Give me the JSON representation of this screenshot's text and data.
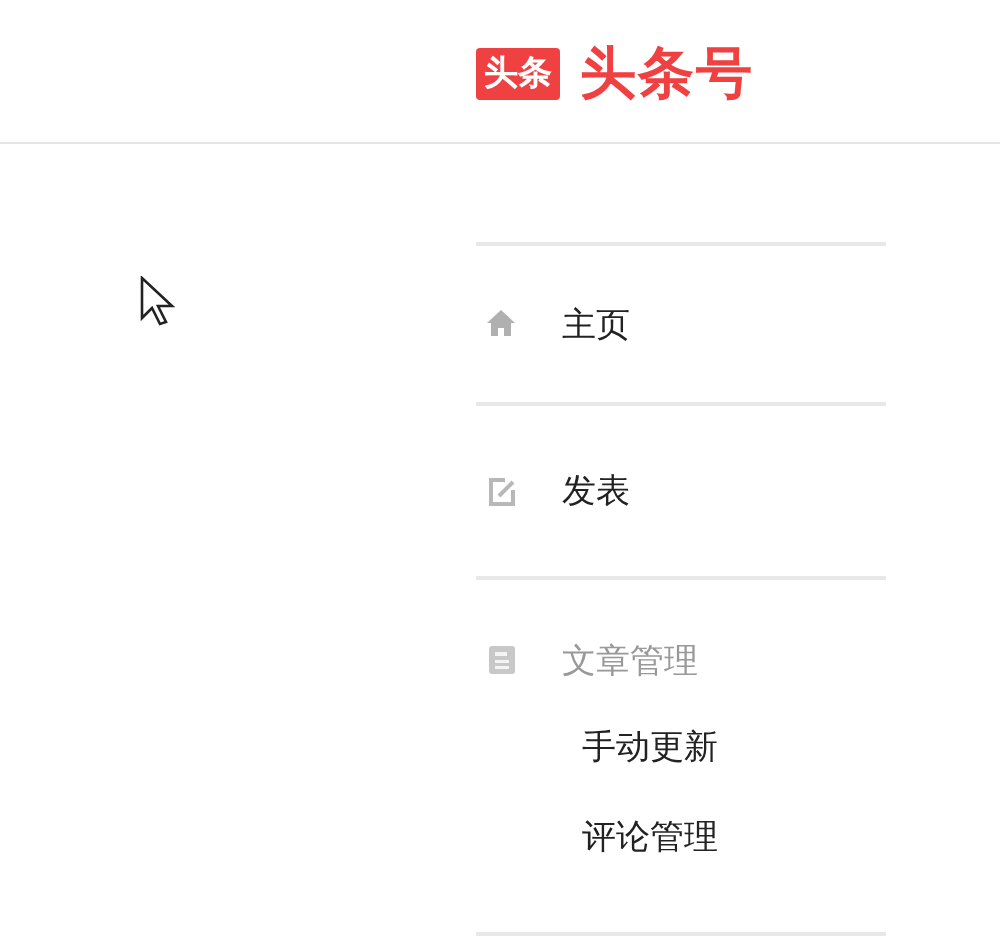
{
  "header": {
    "logo": {
      "badge": "头条",
      "name": "头条号"
    }
  },
  "nav": [
    {
      "kind": "link",
      "label": "主页"
    },
    {
      "kind": "link",
      "label": "发表"
    },
    {
      "kind": "group",
      "label": "文章管理",
      "children": [
        {
          "label": "手动更新"
        },
        {
          "label": "评论管理"
        }
      ]
    }
  ]
}
